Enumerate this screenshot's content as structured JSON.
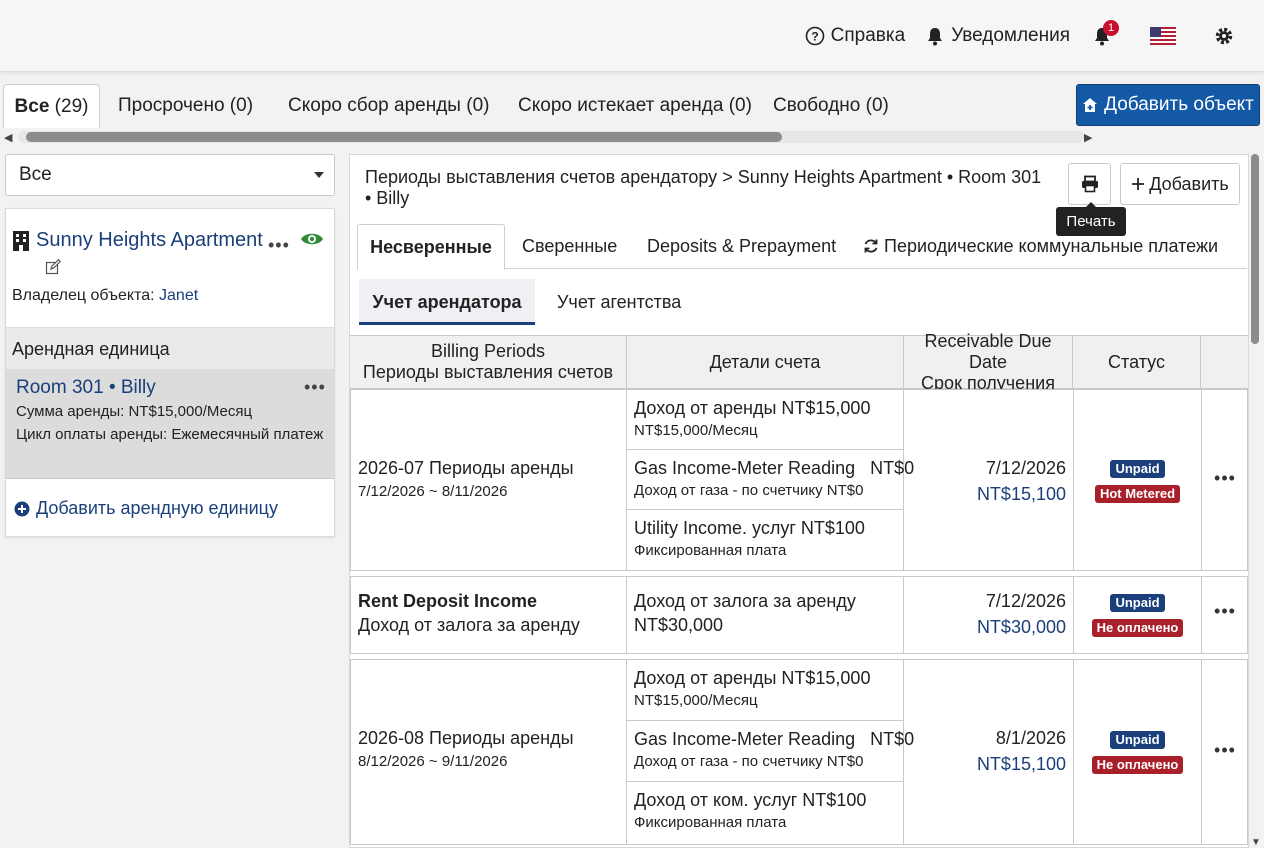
{
  "topnav": {
    "help": "Справка",
    "notifications": "Уведомления",
    "notif_count": "1"
  },
  "filter_tabs": [
    {
      "label": "Все",
      "count": "(29)"
    },
    {
      "label": "Просрочено (0)"
    },
    {
      "label": "Скоро сбор аренды (0)"
    },
    {
      "label": "Скоро истекает аренда (0)"
    },
    {
      "label": "Свободно (0)"
    }
  ],
  "add_object_label": "Добавить объект",
  "left": {
    "select_value": "Все",
    "property_name": "Sunny Heights Apartment",
    "owner_label": "Владелец объекта:",
    "owner_name": "Janet",
    "unit_header": "Арендная единица",
    "unit_name": "Room 301 • Billy",
    "unit_rent": "Сумма аренды: NT$15,000/Месяц",
    "unit_cycle": "Цикл оплаты аренды: Ежемесячный платеж",
    "add_unit": "Добавить арендную единицу"
  },
  "right": {
    "breadcrumb": "Периоды выставления счетов арендатору > Sunny Heights Apartment • Room 301 • Billy",
    "print_tooltip": "Печать",
    "add_label": "Добавить",
    "section_tabs": [
      "Несверенные",
      "Сверенные",
      "Deposits & Prepayment",
      "Периодические коммунальные платежи"
    ],
    "sub_tabs": [
      "Учет арендатора",
      "Учет агентства"
    ],
    "table_headers": {
      "billing_en": "Billing Periods",
      "billing_ru": "Периоды выставления счетов",
      "details": "Детали счета",
      "due_en": "Receivable Due Date",
      "due_ru": "Срок получения",
      "status": "Статус"
    },
    "rows": [
      {
        "period": "2026-07 Периоды аренды",
        "range": "7/12/2026 ~ 8/11/2026",
        "details": [
          {
            "l1": "Доход от аренды NT$15,000",
            "l2": "NT$15,000/Месяц"
          },
          {
            "l1": "Gas Income-Meter Reading   NT$0",
            "l2": "Доход от газа - по счетчику NT$0"
          },
          {
            "l1": "Utility Income. услуг NT$100",
            "l2": "Фиксированная плата"
          }
        ],
        "due_date": "7/12/2026",
        "due_amount": "NT$15,100",
        "status1": "Unpaid",
        "status2": "Hot Metered"
      },
      {
        "period": "Rent Deposit Income",
        "range": "Доход от залога за аренду",
        "details": [
          {
            "l1": "Доход от залога за аренду",
            "l2": "NT$30,000"
          }
        ],
        "due_date": "7/12/2026",
        "due_amount": "NT$30,000",
        "status1": "Unpaid",
        "status2": "Не оплачено"
      },
      {
        "period": "2026-08 Периоды аренды",
        "range": "8/12/2026 ~ 9/11/2026",
        "details": [
          {
            "l1": "Доход от аренды NT$15,000",
            "l2": "NT$15,000/Месяц"
          },
          {
            "l1": "Gas Income-Meter Reading   NT$0",
            "l2": "Доход от газа - по счетчику NT$0"
          },
          {
            "l1": "Доход от ком. услуг NT$100",
            "l2": "Фиксированная плата"
          }
        ],
        "due_date": "8/1/2026",
        "due_amount": "NT$15,100",
        "status1": "Unpaid",
        "status2": "Не оплачено"
      }
    ]
  },
  "colors": {
    "primary": "#1359a6",
    "link": "#1a3f7a",
    "badge_red": "#a8202a",
    "eye_green": "#2e8b3a"
  }
}
